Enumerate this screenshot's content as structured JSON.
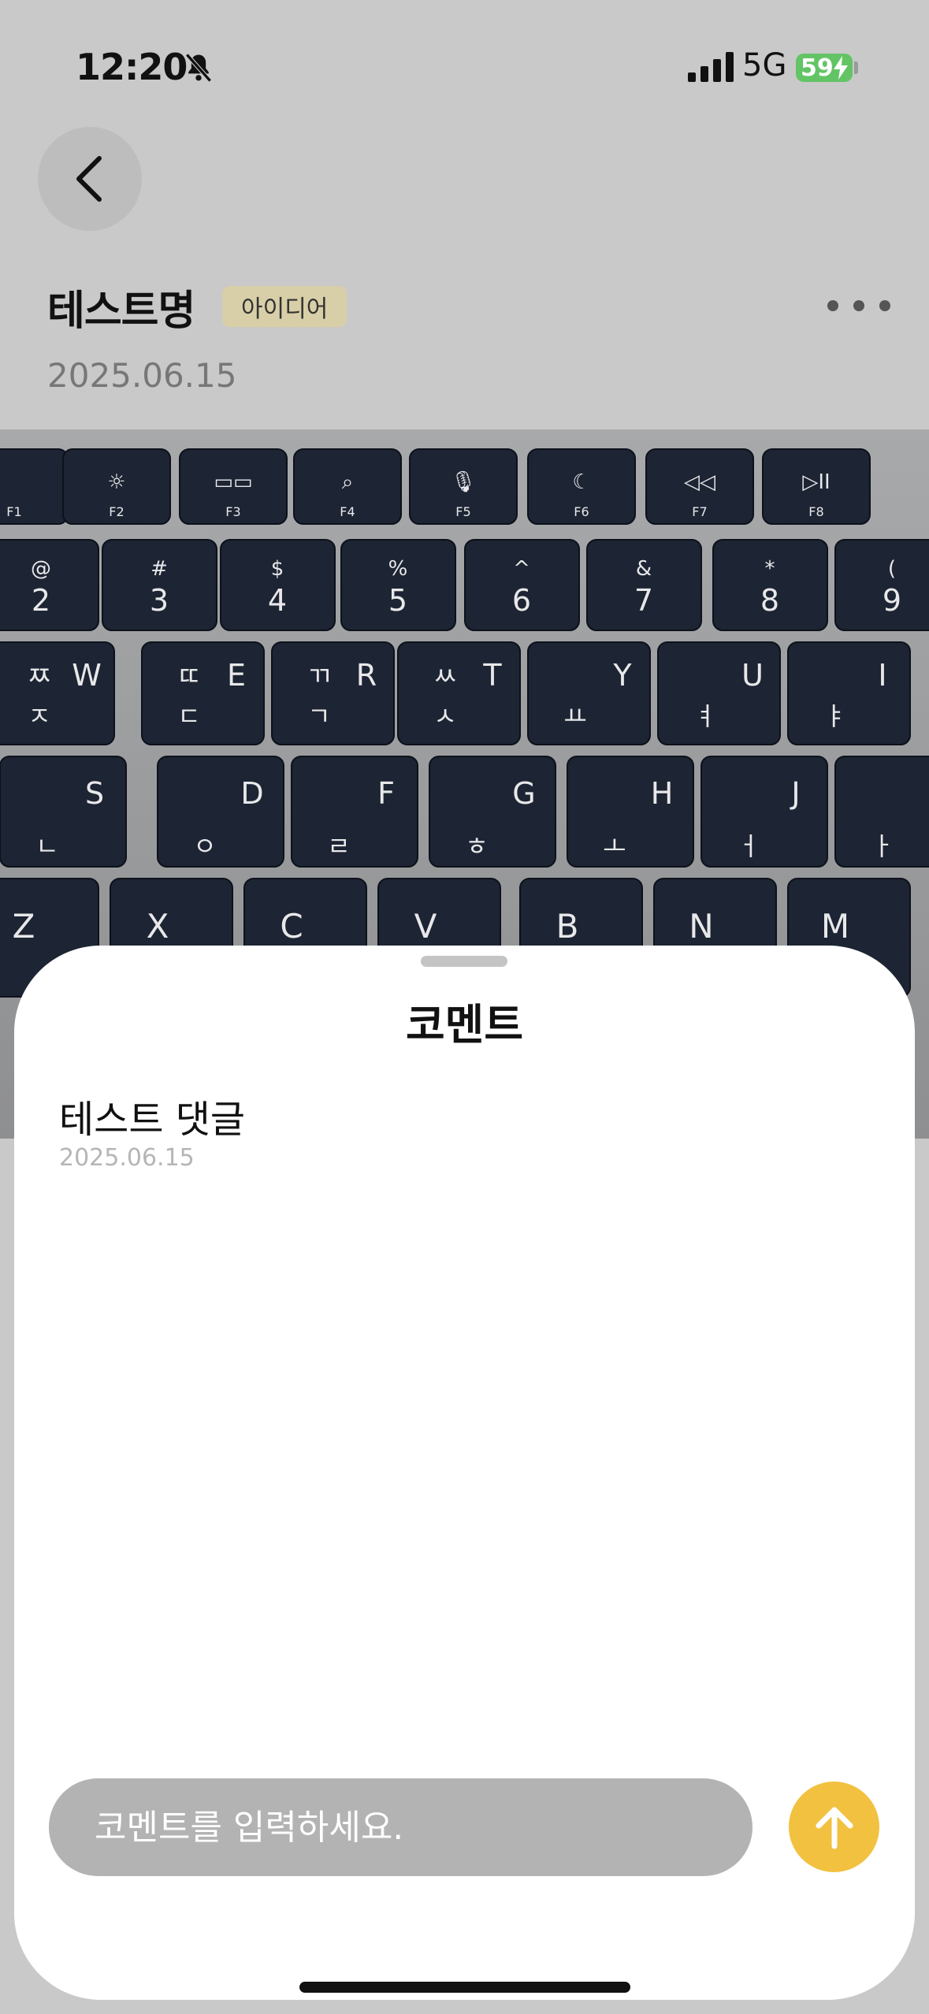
{
  "status_bar": {
    "time": "12:20",
    "network": "5G",
    "battery_level": "59"
  },
  "post": {
    "title": "테스트명",
    "category": "아이디어",
    "date": "2025.06.15"
  },
  "photo": {
    "subject": "keyboard-photo",
    "function_row": [
      [
        "",
        "F1"
      ],
      [
        "☼",
        "F2"
      ],
      [
        "▭▭",
        "F3"
      ],
      [
        "⌕",
        "F4"
      ],
      [
        "🎙",
        "F5"
      ],
      [
        "☾",
        "F6"
      ],
      [
        "◁◁",
        "F7"
      ],
      [
        "▷II",
        "F8"
      ]
    ],
    "number_row": [
      [
        "@",
        "2"
      ],
      [
        "#",
        "3"
      ],
      [
        "$",
        "4"
      ],
      [
        "%",
        "5"
      ],
      [
        "^",
        "6"
      ],
      [
        "&",
        "7"
      ],
      [
        "*",
        "8"
      ],
      [
        "(",
        "9"
      ]
    ],
    "top_row": [
      [
        "ㅉ",
        "W",
        "ㅈ"
      ],
      [
        "ㄸ",
        "E",
        "ㄷ"
      ],
      [
        "ㄲ",
        "R",
        "ㄱ"
      ],
      [
        "ㅆ",
        "T",
        "ㅅ"
      ],
      [
        "",
        "Y",
        "ㅛ"
      ],
      [
        "",
        "U",
        "ㅕ"
      ],
      [
        "",
        "I",
        "ㅑ"
      ]
    ],
    "home_row": [
      [
        "S",
        "ㄴ"
      ],
      [
        "D",
        "ㅇ"
      ],
      [
        "F",
        "ㄹ"
      ],
      [
        "G",
        "ㅎ"
      ],
      [
        "H",
        "ㅗ"
      ],
      [
        "J",
        "ㅓ"
      ],
      [
        "",
        "ㅏ"
      ]
    ],
    "bottom_row": [
      "Z",
      "X",
      "C",
      "V",
      "B",
      "N",
      "M"
    ]
  },
  "comments_sheet": {
    "title": "코멘트",
    "comments": [
      {
        "text": "테스트 댓글",
        "date": "2025.06.15"
      }
    ],
    "input_placeholder": "코멘트를 입력하세요."
  },
  "colors": {
    "background": "#c9c9c9",
    "badge": "#d8cfa8",
    "send_button": "#f2c140",
    "battery": "#63c466"
  }
}
